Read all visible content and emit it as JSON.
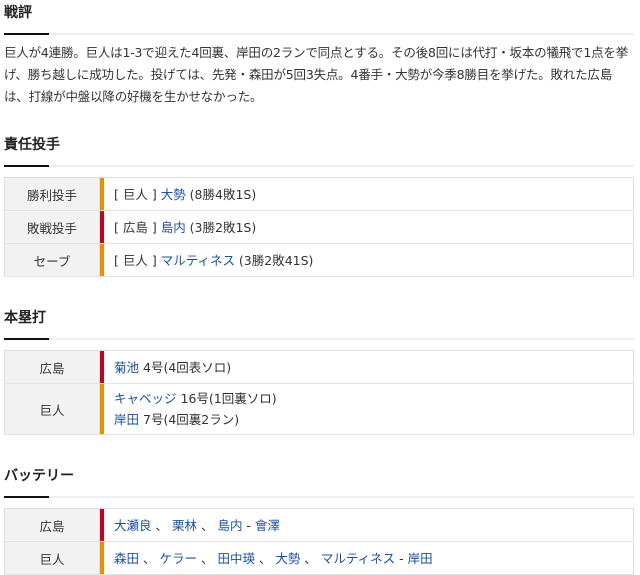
{
  "colors": {
    "hiroshima": "#c8001e",
    "giants": "#f08c00",
    "link": "#1a4fa8"
  },
  "review": {
    "title": "戦評",
    "text": "巨人が4連勝。巨人は1-3で迎えた4回裏、岸田の2ランで同点とする。その後8回には代打・坂本の犠飛で1点を挙げ、勝ち越しに成功した。投げては、先発・森田が5回3失点。4番手・大勢が今季8勝目を挙げた。敗れた広島は、打線が中盤以降の好機を生かせなかった。"
  },
  "pitchers": {
    "title": "責任投手",
    "rows": [
      {
        "label": "勝利投手",
        "team": "[ 巨人 ]",
        "name": "大勢",
        "stat": "(8勝4敗1S)",
        "color": "giants"
      },
      {
        "label": "敗戦投手",
        "team": "[ 広島 ]",
        "name": "島内",
        "stat": "(3勝2敗1S)",
        "color": "hiroshima"
      },
      {
        "label": "セーブ",
        "team": "[ 巨人 ]",
        "name": "マルティネス",
        "stat": "(3勝2敗41S)",
        "color": "giants"
      }
    ]
  },
  "homeruns": {
    "title": "本塁打",
    "rows": [
      {
        "label": "広島",
        "entries": [
          {
            "name": "菊池",
            "detail": "4号(4回表ソロ)"
          }
        ]
      },
      {
        "label": "巨人",
        "entries": [
          {
            "name": "キャベッジ",
            "detail": "16号(1回裏ソロ)"
          },
          {
            "name": "岸田",
            "detail": "7号(4回裏2ラン)"
          }
        ]
      }
    ]
  },
  "battery": {
    "title": "バッテリー",
    "rows": [
      {
        "label": "広島",
        "pitchers": [
          "大瀬良",
          "栗林",
          "島内"
        ],
        "catcher": "會澤"
      },
      {
        "label": "巨人",
        "pitchers": [
          "森田",
          "ケラー",
          "田中瑛",
          "大勢",
          "マルティネス"
        ],
        "catcher": "岸田"
      }
    ]
  }
}
